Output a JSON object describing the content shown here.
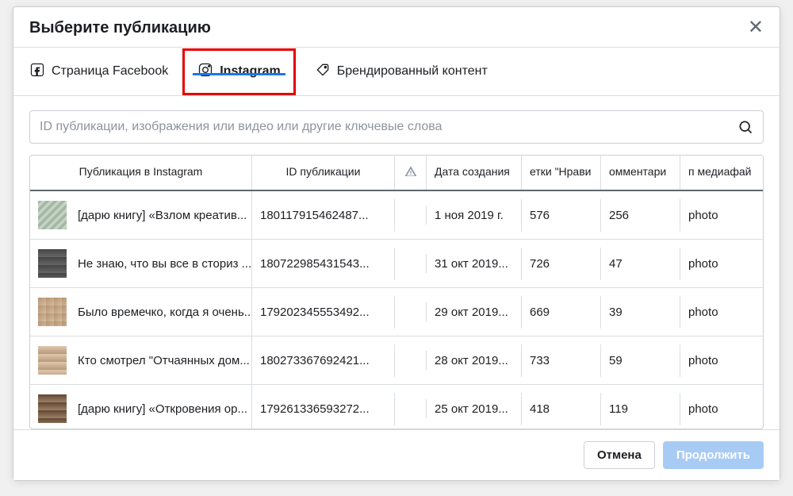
{
  "modal": {
    "title": "Выберите публикацию"
  },
  "tabs": {
    "facebook": "Страница Facebook",
    "instagram": "Instagram",
    "branded": "Брендированный контент"
  },
  "search": {
    "placeholder": "ID публикации, изображения или видео или другие ключевые слова"
  },
  "table": {
    "headers": {
      "post": "Публикация в Instagram",
      "id": "ID публикации",
      "date": "Дата создания",
      "likes": "етки \"Нрави",
      "comments": "омментари",
      "media": "п медиафай"
    }
  },
  "rows": [
    {
      "title": "[дарю книгу] «Взлом креатив...",
      "id": "180117915462487...",
      "date": "1 ноя 2019 г.",
      "likes": "576",
      "comments": "256",
      "media": "photo"
    },
    {
      "title": "Не знаю, что вы все в сториз ...",
      "id": "180722985431543...",
      "date": "31 окт 2019...",
      "likes": "726",
      "comments": "47",
      "media": "photo"
    },
    {
      "title": "Было времечко, когда я очень...",
      "id": "179202345553492...",
      "date": "29 окт 2019...",
      "likes": "669",
      "comments": "39",
      "media": "photo"
    },
    {
      "title": "Кто смотрел \"Отчаянных дом...",
      "id": "180273367692421...",
      "date": "28 окт 2019...",
      "likes": "733",
      "comments": "59",
      "media": "photo"
    },
    {
      "title": "[дарю книгу] «Откровения ор...",
      "id": "179261336593272...",
      "date": "25 окт 2019...",
      "likes": "418",
      "comments": "119",
      "media": "photo"
    }
  ],
  "footer": {
    "cancel": "Отмена",
    "continue": "Продолжить"
  }
}
